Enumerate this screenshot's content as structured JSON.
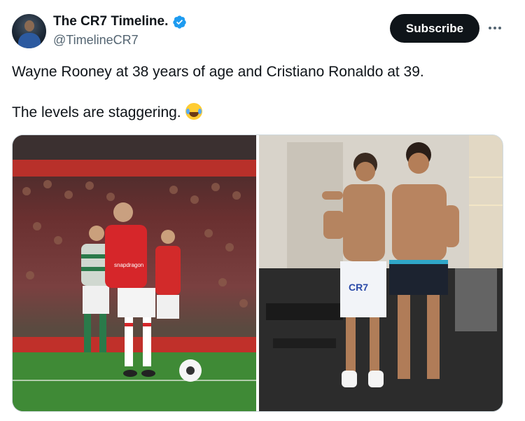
{
  "account": {
    "display_name": "The CR7 Timeline.",
    "handle": "@TimelineCR7",
    "verified": true,
    "avatar_icon": "profile-avatar"
  },
  "actions": {
    "subscribe_label": "Subscribe",
    "more_icon": "more-dots-icon"
  },
  "tweet": {
    "line1": "Wayne Rooney at 38 years of age and Cristiano Ronaldo at 39.",
    "line2": "The levels are staggering.",
    "emoji": "😂"
  },
  "media": {
    "left_photo": {
      "description_icon": "football-match-photo",
      "shirt_sponsor": "snapdragon"
    },
    "right_photo": {
      "description_icon": "gym-photo",
      "shorts_text": "CR7"
    }
  },
  "colors": {
    "subscribe_bg": "#0f1419",
    "verified_blue": "#1d9bf0",
    "handle_gray": "#536471",
    "border": "#cfd9de"
  }
}
